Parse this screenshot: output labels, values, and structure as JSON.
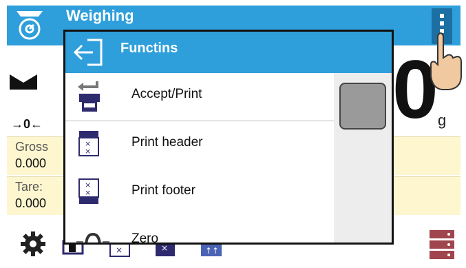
{
  "header": {
    "title": "Weighing"
  },
  "display": {
    "main_reading_digit": "0",
    "zero_indicator": "→0←",
    "unit": "g"
  },
  "info": {
    "gross_label": "Gross",
    "gross_value": "0.000",
    "tare_label": "Tare:",
    "tare_value": "0.000"
  },
  "modal": {
    "title": "Functins",
    "items": [
      {
        "label": "Accept/Print",
        "icon": "printer-accept-icon"
      },
      {
        "label": "Print header",
        "icon": "print-header-icon"
      },
      {
        "label": "Print footer",
        "icon": "print-footer-icon"
      },
      {
        "label": "Zero",
        "icon": "zero-icon"
      }
    ]
  },
  "colors": {
    "accent": "#2f9fdb",
    "info_bg": "#fdf6cf",
    "navy": "#2e2a6e"
  }
}
